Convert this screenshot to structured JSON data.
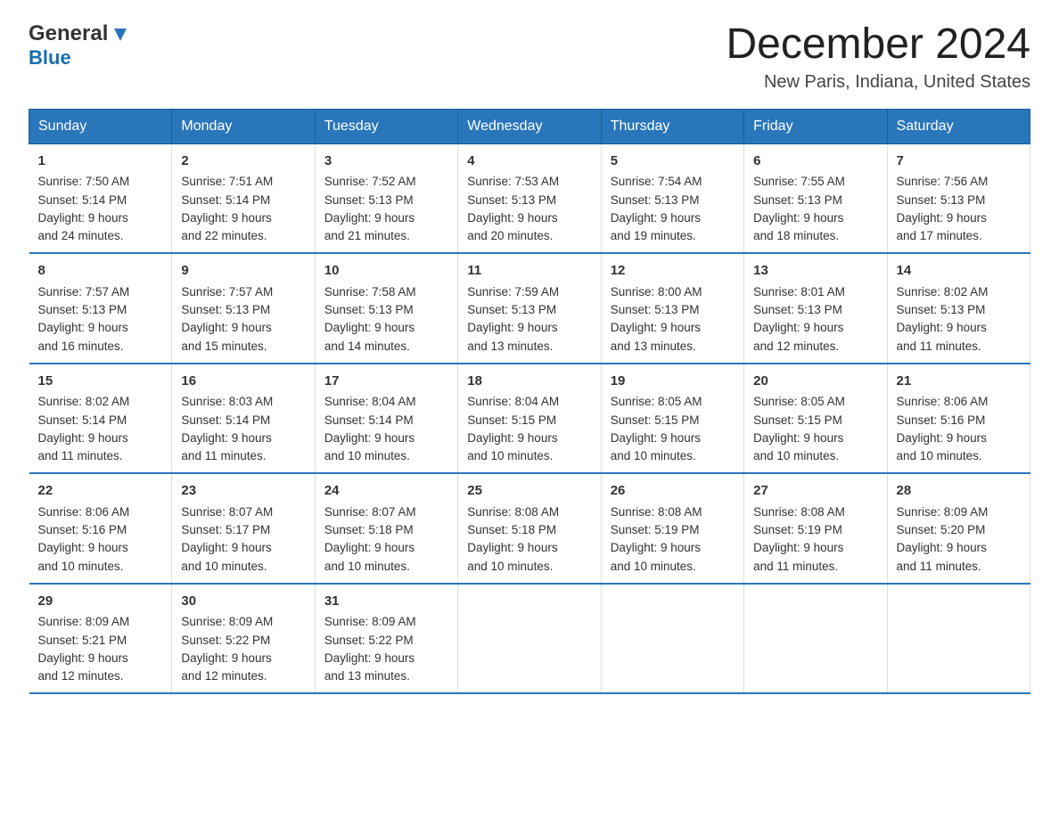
{
  "logo": {
    "general": "General",
    "blue": "Blue"
  },
  "title": "December 2024",
  "location": "New Paris, Indiana, United States",
  "weekdays": [
    "Sunday",
    "Monday",
    "Tuesday",
    "Wednesday",
    "Thursday",
    "Friday",
    "Saturday"
  ],
  "weeks": [
    [
      {
        "day": "1",
        "sunrise": "Sunrise: 7:50 AM",
        "sunset": "Sunset: 5:14 PM",
        "daylight": "Daylight: 9 hours",
        "daylight2": "and 24 minutes."
      },
      {
        "day": "2",
        "sunrise": "Sunrise: 7:51 AM",
        "sunset": "Sunset: 5:14 PM",
        "daylight": "Daylight: 9 hours",
        "daylight2": "and 22 minutes."
      },
      {
        "day": "3",
        "sunrise": "Sunrise: 7:52 AM",
        "sunset": "Sunset: 5:13 PM",
        "daylight": "Daylight: 9 hours",
        "daylight2": "and 21 minutes."
      },
      {
        "day": "4",
        "sunrise": "Sunrise: 7:53 AM",
        "sunset": "Sunset: 5:13 PM",
        "daylight": "Daylight: 9 hours",
        "daylight2": "and 20 minutes."
      },
      {
        "day": "5",
        "sunrise": "Sunrise: 7:54 AM",
        "sunset": "Sunset: 5:13 PM",
        "daylight": "Daylight: 9 hours",
        "daylight2": "and 19 minutes."
      },
      {
        "day": "6",
        "sunrise": "Sunrise: 7:55 AM",
        "sunset": "Sunset: 5:13 PM",
        "daylight": "Daylight: 9 hours",
        "daylight2": "and 18 minutes."
      },
      {
        "day": "7",
        "sunrise": "Sunrise: 7:56 AM",
        "sunset": "Sunset: 5:13 PM",
        "daylight": "Daylight: 9 hours",
        "daylight2": "and 17 minutes."
      }
    ],
    [
      {
        "day": "8",
        "sunrise": "Sunrise: 7:57 AM",
        "sunset": "Sunset: 5:13 PM",
        "daylight": "Daylight: 9 hours",
        "daylight2": "and 16 minutes."
      },
      {
        "day": "9",
        "sunrise": "Sunrise: 7:57 AM",
        "sunset": "Sunset: 5:13 PM",
        "daylight": "Daylight: 9 hours",
        "daylight2": "and 15 minutes."
      },
      {
        "day": "10",
        "sunrise": "Sunrise: 7:58 AM",
        "sunset": "Sunset: 5:13 PM",
        "daylight": "Daylight: 9 hours",
        "daylight2": "and 14 minutes."
      },
      {
        "day": "11",
        "sunrise": "Sunrise: 7:59 AM",
        "sunset": "Sunset: 5:13 PM",
        "daylight": "Daylight: 9 hours",
        "daylight2": "and 13 minutes."
      },
      {
        "day": "12",
        "sunrise": "Sunrise: 8:00 AM",
        "sunset": "Sunset: 5:13 PM",
        "daylight": "Daylight: 9 hours",
        "daylight2": "and 13 minutes."
      },
      {
        "day": "13",
        "sunrise": "Sunrise: 8:01 AM",
        "sunset": "Sunset: 5:13 PM",
        "daylight": "Daylight: 9 hours",
        "daylight2": "and 12 minutes."
      },
      {
        "day": "14",
        "sunrise": "Sunrise: 8:02 AM",
        "sunset": "Sunset: 5:13 PM",
        "daylight": "Daylight: 9 hours",
        "daylight2": "and 11 minutes."
      }
    ],
    [
      {
        "day": "15",
        "sunrise": "Sunrise: 8:02 AM",
        "sunset": "Sunset: 5:14 PM",
        "daylight": "Daylight: 9 hours",
        "daylight2": "and 11 minutes."
      },
      {
        "day": "16",
        "sunrise": "Sunrise: 8:03 AM",
        "sunset": "Sunset: 5:14 PM",
        "daylight": "Daylight: 9 hours",
        "daylight2": "and 11 minutes."
      },
      {
        "day": "17",
        "sunrise": "Sunrise: 8:04 AM",
        "sunset": "Sunset: 5:14 PM",
        "daylight": "Daylight: 9 hours",
        "daylight2": "and 10 minutes."
      },
      {
        "day": "18",
        "sunrise": "Sunrise: 8:04 AM",
        "sunset": "Sunset: 5:15 PM",
        "daylight": "Daylight: 9 hours",
        "daylight2": "and 10 minutes."
      },
      {
        "day": "19",
        "sunrise": "Sunrise: 8:05 AM",
        "sunset": "Sunset: 5:15 PM",
        "daylight": "Daylight: 9 hours",
        "daylight2": "and 10 minutes."
      },
      {
        "day": "20",
        "sunrise": "Sunrise: 8:05 AM",
        "sunset": "Sunset: 5:15 PM",
        "daylight": "Daylight: 9 hours",
        "daylight2": "and 10 minutes."
      },
      {
        "day": "21",
        "sunrise": "Sunrise: 8:06 AM",
        "sunset": "Sunset: 5:16 PM",
        "daylight": "Daylight: 9 hours",
        "daylight2": "and 10 minutes."
      }
    ],
    [
      {
        "day": "22",
        "sunrise": "Sunrise: 8:06 AM",
        "sunset": "Sunset: 5:16 PM",
        "daylight": "Daylight: 9 hours",
        "daylight2": "and 10 minutes."
      },
      {
        "day": "23",
        "sunrise": "Sunrise: 8:07 AM",
        "sunset": "Sunset: 5:17 PM",
        "daylight": "Daylight: 9 hours",
        "daylight2": "and 10 minutes."
      },
      {
        "day": "24",
        "sunrise": "Sunrise: 8:07 AM",
        "sunset": "Sunset: 5:18 PM",
        "daylight": "Daylight: 9 hours",
        "daylight2": "and 10 minutes."
      },
      {
        "day": "25",
        "sunrise": "Sunrise: 8:08 AM",
        "sunset": "Sunset: 5:18 PM",
        "daylight": "Daylight: 9 hours",
        "daylight2": "and 10 minutes."
      },
      {
        "day": "26",
        "sunrise": "Sunrise: 8:08 AM",
        "sunset": "Sunset: 5:19 PM",
        "daylight": "Daylight: 9 hours",
        "daylight2": "and 10 minutes."
      },
      {
        "day": "27",
        "sunrise": "Sunrise: 8:08 AM",
        "sunset": "Sunset: 5:19 PM",
        "daylight": "Daylight: 9 hours",
        "daylight2": "and 11 minutes."
      },
      {
        "day": "28",
        "sunrise": "Sunrise: 8:09 AM",
        "sunset": "Sunset: 5:20 PM",
        "daylight": "Daylight: 9 hours",
        "daylight2": "and 11 minutes."
      }
    ],
    [
      {
        "day": "29",
        "sunrise": "Sunrise: 8:09 AM",
        "sunset": "Sunset: 5:21 PM",
        "daylight": "Daylight: 9 hours",
        "daylight2": "and 12 minutes."
      },
      {
        "day": "30",
        "sunrise": "Sunrise: 8:09 AM",
        "sunset": "Sunset: 5:22 PM",
        "daylight": "Daylight: 9 hours",
        "daylight2": "and 12 minutes."
      },
      {
        "day": "31",
        "sunrise": "Sunrise: 8:09 AM",
        "sunset": "Sunset: 5:22 PM",
        "daylight": "Daylight: 9 hours",
        "daylight2": "and 13 minutes."
      },
      null,
      null,
      null,
      null
    ]
  ]
}
